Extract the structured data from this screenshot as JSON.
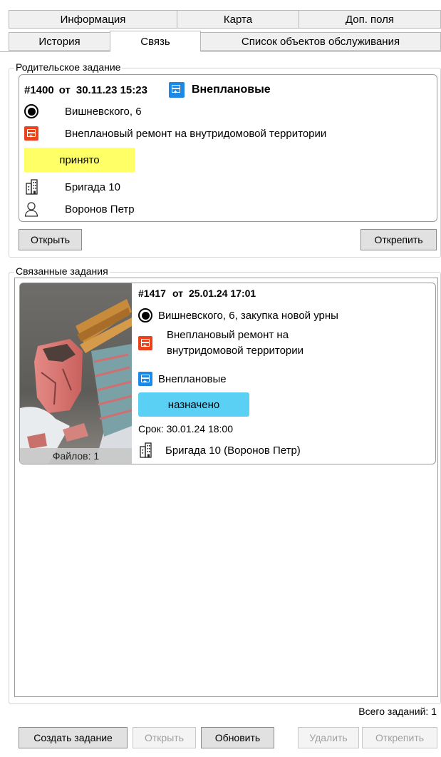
{
  "tabs_row1": [
    {
      "label": "Информация"
    },
    {
      "label": "Карта"
    },
    {
      "label": "Доп. поля"
    }
  ],
  "tabs_row2": [
    {
      "label": "История"
    },
    {
      "label": "Связь",
      "active": true
    },
    {
      "label": "Список объектов обслуживания"
    }
  ],
  "parent": {
    "group_title": "Родительское задание",
    "number": "#1400",
    "from_word": "от",
    "datetime": "30.11.23 15:23",
    "category": "Внеплановые",
    "address": "Вишневского, 6",
    "work_type": "Внеплановый ремонт на внутридомовой территории",
    "status": "принято",
    "brigade": "Бригада 10",
    "person": "Воронов Петр",
    "open_button": "Открыть",
    "detach_button": "Открепить"
  },
  "related": {
    "group_title": "Связанные задания",
    "items": [
      {
        "number": "#1417",
        "from_word": "от",
        "datetime": "25.01.24 17:01",
        "address": "Вишневского, 6, закупка новой урны",
        "work_type_line1": "Внеплановый ремонт на",
        "work_type_line2": "внутридомовой территории",
        "category": "Внеплановые",
        "status": "назначено",
        "deadline": "Срок: 30.01.24 18:00",
        "brigade": "Бригада 10  (Воронов Петр)",
        "files": "Файлов: 1"
      }
    ],
    "total": "Всего заданий: 1"
  },
  "footer": {
    "create": "Создать задание",
    "open": "Открыть",
    "refresh": "Обновить",
    "delete": "Удалить",
    "detach": "Открепить"
  },
  "colors": {
    "accepted": "#ffff66",
    "assigned": "#5bd0f5",
    "work_icon": "#e8431c",
    "category_icon": "#1e88e5"
  },
  "icons": {
    "address": "radio-target-icon",
    "work": "repair-form-icon",
    "category": "unplanned-form-icon",
    "brigade": "building-icon",
    "person": "person-icon"
  }
}
